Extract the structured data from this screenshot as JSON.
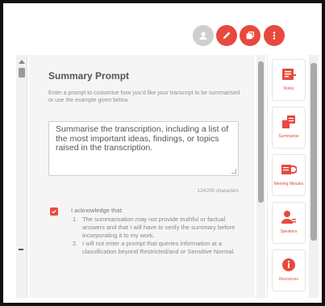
{
  "header": {
    "buttons": [
      {
        "icon": "user-icon",
        "state": "disabled"
      },
      {
        "icon": "pencil-icon",
        "state": "active"
      },
      {
        "icon": "copy-icon",
        "state": "active"
      },
      {
        "icon": "more-icon",
        "state": "active"
      }
    ]
  },
  "main": {
    "title": "Summary Prompt",
    "description": "Enter a prompt to customise how you'd like your transcript to be summarised or use the example given below.",
    "prompt_value": "Summarise the transcription, including a list of the most important ideas, findings, or topics raised in the transcription.",
    "char_count": "124/200 characters",
    "ack_label": "I acknowledge that:",
    "ack_items": [
      {
        "num": "1.",
        "text": "The summarisation may not provide truthful or factual answers and that I will have to verify the summary before incorporating it to my work."
      },
      {
        "num": "2.",
        "text": "I will not enter a prompt that queries information at a classification beyond Restricted/and or Sensitive Normal."
      }
    ]
  },
  "sidebar": {
    "items": [
      {
        "icon": "notes-icon",
        "label": "Notes"
      },
      {
        "icon": "summarise-icon",
        "label": "Summarise"
      },
      {
        "icon": "meeting-minutes-icon",
        "label": "Meeting Minutes"
      },
      {
        "icon": "speakers-icon",
        "label": "Speakers"
      },
      {
        "icon": "resources-icon",
        "label": "Resources"
      }
    ]
  },
  "colors": {
    "accent": "#e8493d",
    "disabled": "#cfcfcf",
    "panel_bg": "#f5f5f5"
  }
}
